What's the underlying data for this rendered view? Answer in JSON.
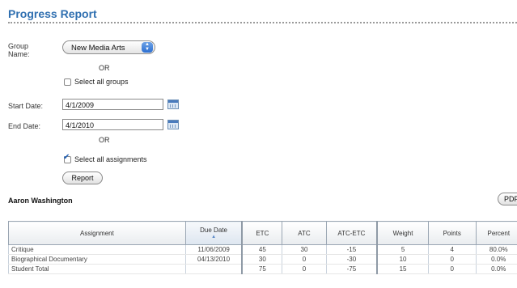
{
  "page": {
    "title": "Progress Report"
  },
  "filters": {
    "group_label": "Group Name:",
    "group_value": "New Media Arts",
    "or_1": "OR",
    "select_all_groups": {
      "label": "Select all groups",
      "checked": false
    },
    "start_label": "Start Date:",
    "start_value": "4/1/2009",
    "end_label": "End Date:",
    "end_value": "4/1/2010",
    "or_2": "OR",
    "select_all_assignments": {
      "label": "Select all assignments",
      "checked": true
    },
    "report_button": "Report"
  },
  "student": {
    "name": "Aaron Washington",
    "pdf_button": "PDF"
  },
  "table": {
    "headers": [
      "Assignment",
      "Due Date",
      "ETC",
      "ATC",
      "ATC-ETC",
      "Weight",
      "Points",
      "Percent"
    ],
    "sorted_column": "Due Date",
    "rows": [
      [
        "Critique",
        "11/06/2009",
        "45",
        "30",
        "-15",
        "5",
        "4",
        "80.0%"
      ],
      [
        "Biographical Documentary",
        "04/13/2010",
        "30",
        "0",
        "-30",
        "10",
        "0",
        "0.0%"
      ],
      [
        "Student Total",
        "",
        "75",
        "0",
        "-75",
        "15",
        "0",
        "0.0%"
      ]
    ]
  },
  "colors": {
    "title": "#2f6fb0",
    "accent": "#2c6fd1"
  },
  "icons": {
    "select_stepper": "stepper-arrows-icon",
    "calendar": "calendar-icon",
    "sort": "sort-ascending-icon"
  }
}
